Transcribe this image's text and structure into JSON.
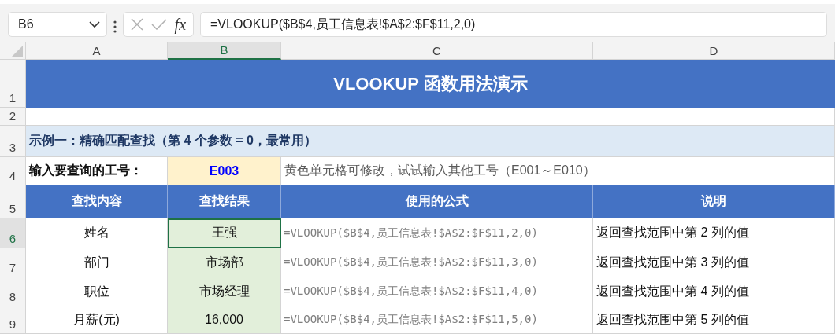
{
  "name_box": {
    "value": "B6"
  },
  "formula_bar": {
    "fx_label": "fx",
    "value": "=VLOOKUP($B$4,员工信息表!$A$2:$F$11,2,0)"
  },
  "column_headers": [
    {
      "label": "A",
      "selected": false
    },
    {
      "label": "B",
      "selected": true
    },
    {
      "label": "C",
      "selected": false
    },
    {
      "label": "D",
      "selected": false
    }
  ],
  "row_headers": [
    {
      "label": "1",
      "selected": false
    },
    {
      "label": "2",
      "selected": false
    },
    {
      "label": "3",
      "selected": false
    },
    {
      "label": "4",
      "selected": false
    },
    {
      "label": "5",
      "selected": false
    },
    {
      "label": "6",
      "selected": true
    },
    {
      "label": "7",
      "selected": false
    },
    {
      "label": "8",
      "selected": false
    },
    {
      "label": "9",
      "selected": false
    }
  ],
  "title": "VLOOKUP 函数用法演示",
  "section_heading": "示例一：精确匹配查找（第 4 个参数 = 0，最常用）",
  "input_row": {
    "label": "输入要查询的工号：",
    "value": "E003",
    "hint": "黄色单元格可修改，试试输入其他工号（E001～E010）"
  },
  "table_header": [
    "查找内容",
    "查找结果",
    "使用的公式",
    "说明"
  ],
  "table_rows": [
    {
      "item": "姓名",
      "result": "王强",
      "selected": true,
      "formula": "=VLOOKUP($B$4,员工信息表!$A$2:$F$11,2,0)",
      "note": "返回查找范围中第 2 列的值"
    },
    {
      "item": "部门",
      "result": "市场部",
      "selected": false,
      "formula": "=VLOOKUP($B$4,员工信息表!$A$2:$F$11,3,0)",
      "note": "返回查找范围中第 3 列的值"
    },
    {
      "item": "职位",
      "result": "市场经理",
      "selected": false,
      "formula": "=VLOOKUP($B$4,员工信息表!$A$2:$F$11,4,0)",
      "note": "返回查找范围中第 4 列的值"
    },
    {
      "item": "月薪(元)",
      "result": "16,000",
      "selected": false,
      "formula": "=VLOOKUP($B$4,员工信息表!$A$2:$F$11,5,0)",
      "note": "返回查找范围中第 5 列的值"
    }
  ]
}
